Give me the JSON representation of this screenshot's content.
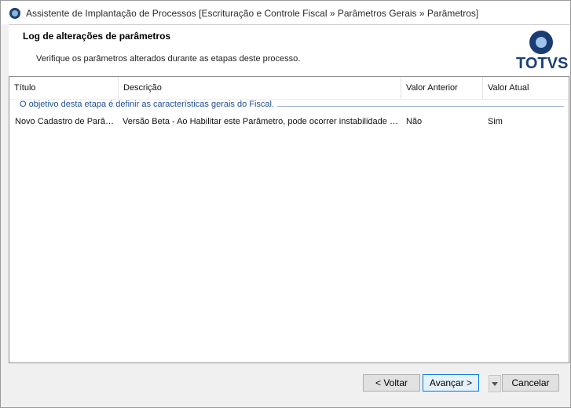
{
  "window": {
    "title": "Assistente de Implantação de Processos [Escrituração e Controle Fiscal » Parâmetros Gerais » Parâmetros]"
  },
  "header": {
    "title": "Log de alterações de parâmetros",
    "subtitle": "Verifique os parâmetros alterados durante as etapas deste processo.",
    "logo_text": "TOTVS"
  },
  "grid": {
    "columns": [
      "Título",
      "Descrição",
      "Valor Anterior",
      "Valor Atual"
    ],
    "group_label": "O objetivo desta etapa é definir as características gerais do Fiscal.",
    "rows": [
      {
        "titulo": "Novo Cadastro de Parâm...",
        "descricao": "Versão Beta - Ao Habilitar este Parâmetro, pode ocorrer instabilidade em...",
        "valor_anterior": "Não",
        "valor_atual": "Sim"
      }
    ]
  },
  "footer": {
    "back_label": "< Voltar",
    "next_label": "Avançar >",
    "cancel_label": "Cancelar"
  },
  "colors": {
    "accent": "#0078d7",
    "group_text": "#1f5096",
    "logo": "#1c3f78"
  }
}
